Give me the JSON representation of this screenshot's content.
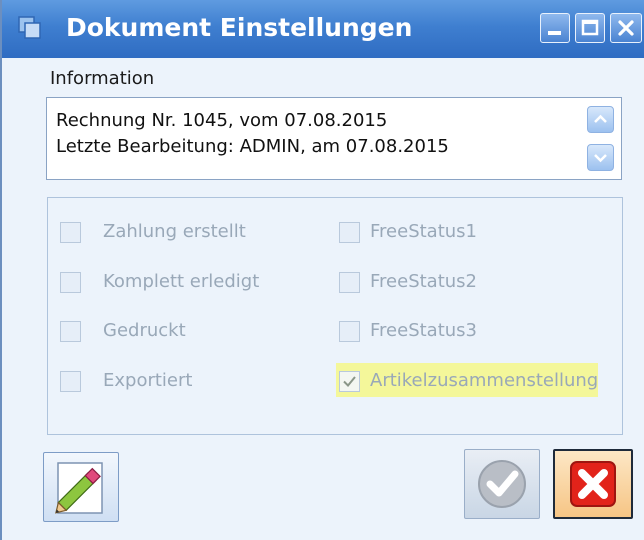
{
  "window": {
    "title": "Dokument Einstellungen",
    "controls": [
      "minimize",
      "maximize",
      "close"
    ]
  },
  "information": {
    "label": "Information",
    "lines": [
      "Rechnung Nr. 1045, vom 07.08.2015",
      "Letzte Bearbeitung: ADMIN, am 07.08.2015"
    ]
  },
  "status": {
    "left": [
      {
        "label": "Zahlung erstellt",
        "checked": false
      },
      {
        "label": "Komplett erledigt",
        "checked": false
      },
      {
        "label": "Gedruckt",
        "checked": false
      },
      {
        "label": "Exportiert",
        "checked": false
      }
    ],
    "right": [
      {
        "label": "FreeStatus1",
        "checked": false
      },
      {
        "label": "FreeStatus2",
        "checked": false
      },
      {
        "label": "FreeStatus3",
        "checked": false
      },
      {
        "label": "Artikelzusammenstellung",
        "checked": true
      }
    ],
    "highlight_color": "#f4f79a"
  },
  "buttons": {
    "edit": "pencil-icon",
    "ok": "checkmark-icon",
    "cancel": "close-x-icon"
  },
  "colors": {
    "titlebar": "#3f7fd0",
    "body": "#ecf3fb",
    "disabled_text": "#99a8b8"
  }
}
